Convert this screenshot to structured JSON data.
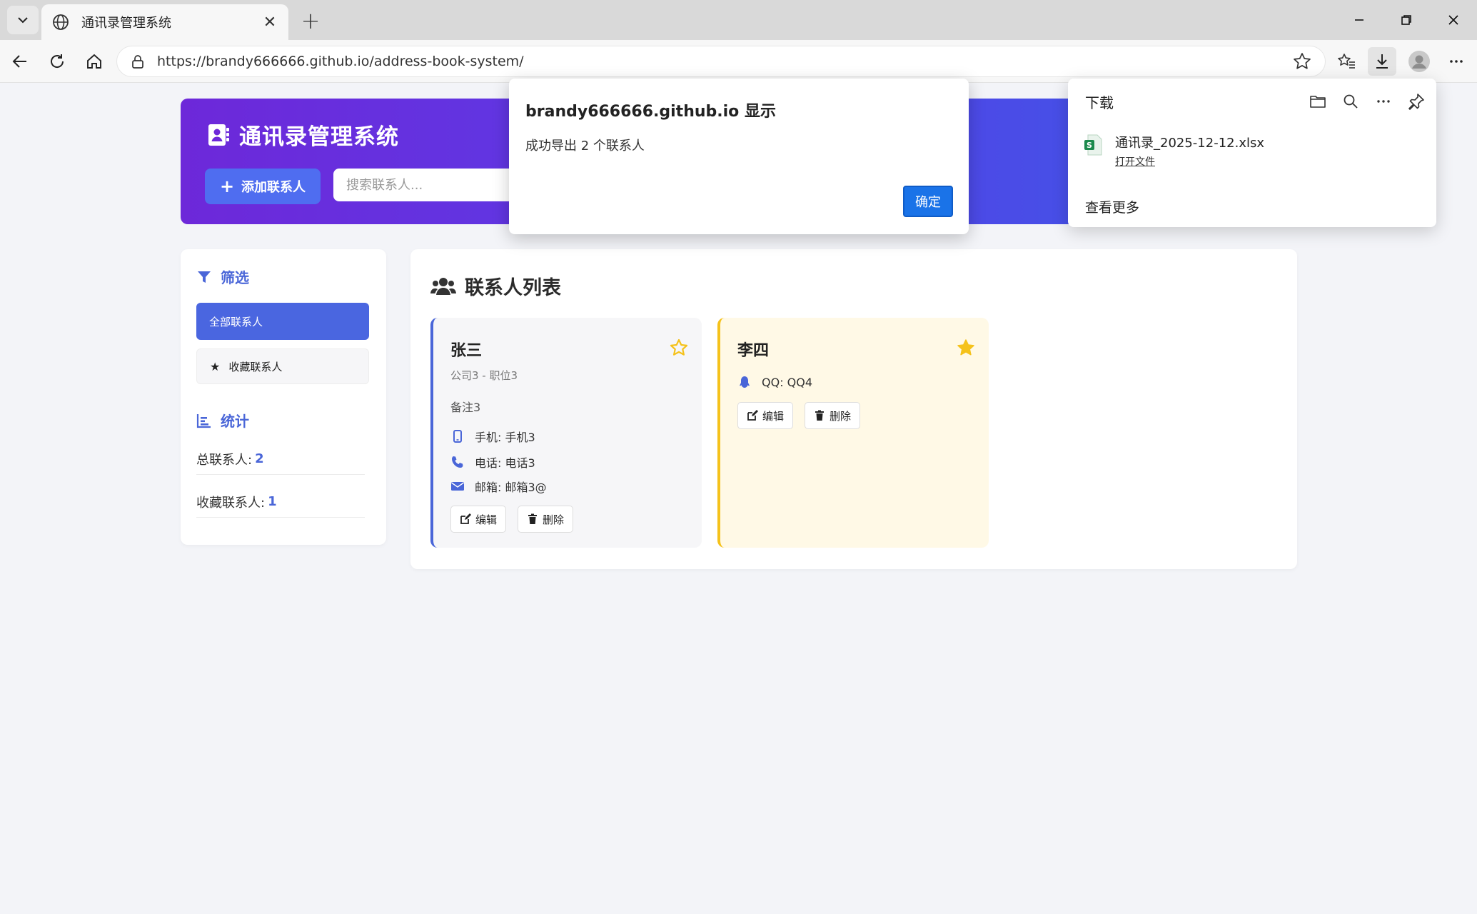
{
  "browser": {
    "tab_title": "通讯录管理系统",
    "url": "https://brandy666666.github.io/address-book-system/"
  },
  "app": {
    "title": "通讯录管理系统",
    "add_button": "添加联系人",
    "search_placeholder": "搜索联系人..."
  },
  "sidebar": {
    "filter_heading": "筛选",
    "filter_all": "全部联系人",
    "filter_favorites": "收藏联系人",
    "stats_heading": "统计",
    "stats": [
      {
        "label": "总联系人:",
        "value": "2"
      },
      {
        "label": "收藏联系人:",
        "value": "1"
      }
    ]
  },
  "main": {
    "title": "联系人列表",
    "contacts": [
      {
        "name": "张三",
        "favorite": false,
        "company": "公司3 - 职位3",
        "note": "备注3",
        "mobile": "手机: 手机3",
        "phone": "电话: 电话3",
        "email": "邮箱: 邮箱3@",
        "edit": "编辑",
        "delete": "删除"
      },
      {
        "name": "李四",
        "favorite": true,
        "qq": "QQ: QQ4",
        "edit": "编辑",
        "delete": "删除"
      }
    ]
  },
  "dialog": {
    "title": "brandy666666.github.io 显示",
    "message": "成功导出 2 个联系人",
    "ok": "确定"
  },
  "downloads": {
    "title": "下载",
    "file_name": "通讯录_2025-12-12.xlsx",
    "open_file": "打开文件",
    "see_more": "查看更多"
  },
  "colors": {
    "accent": "#4a66e0",
    "favorite": "#f5c21b",
    "dialog_button": "#1a73e8"
  }
}
